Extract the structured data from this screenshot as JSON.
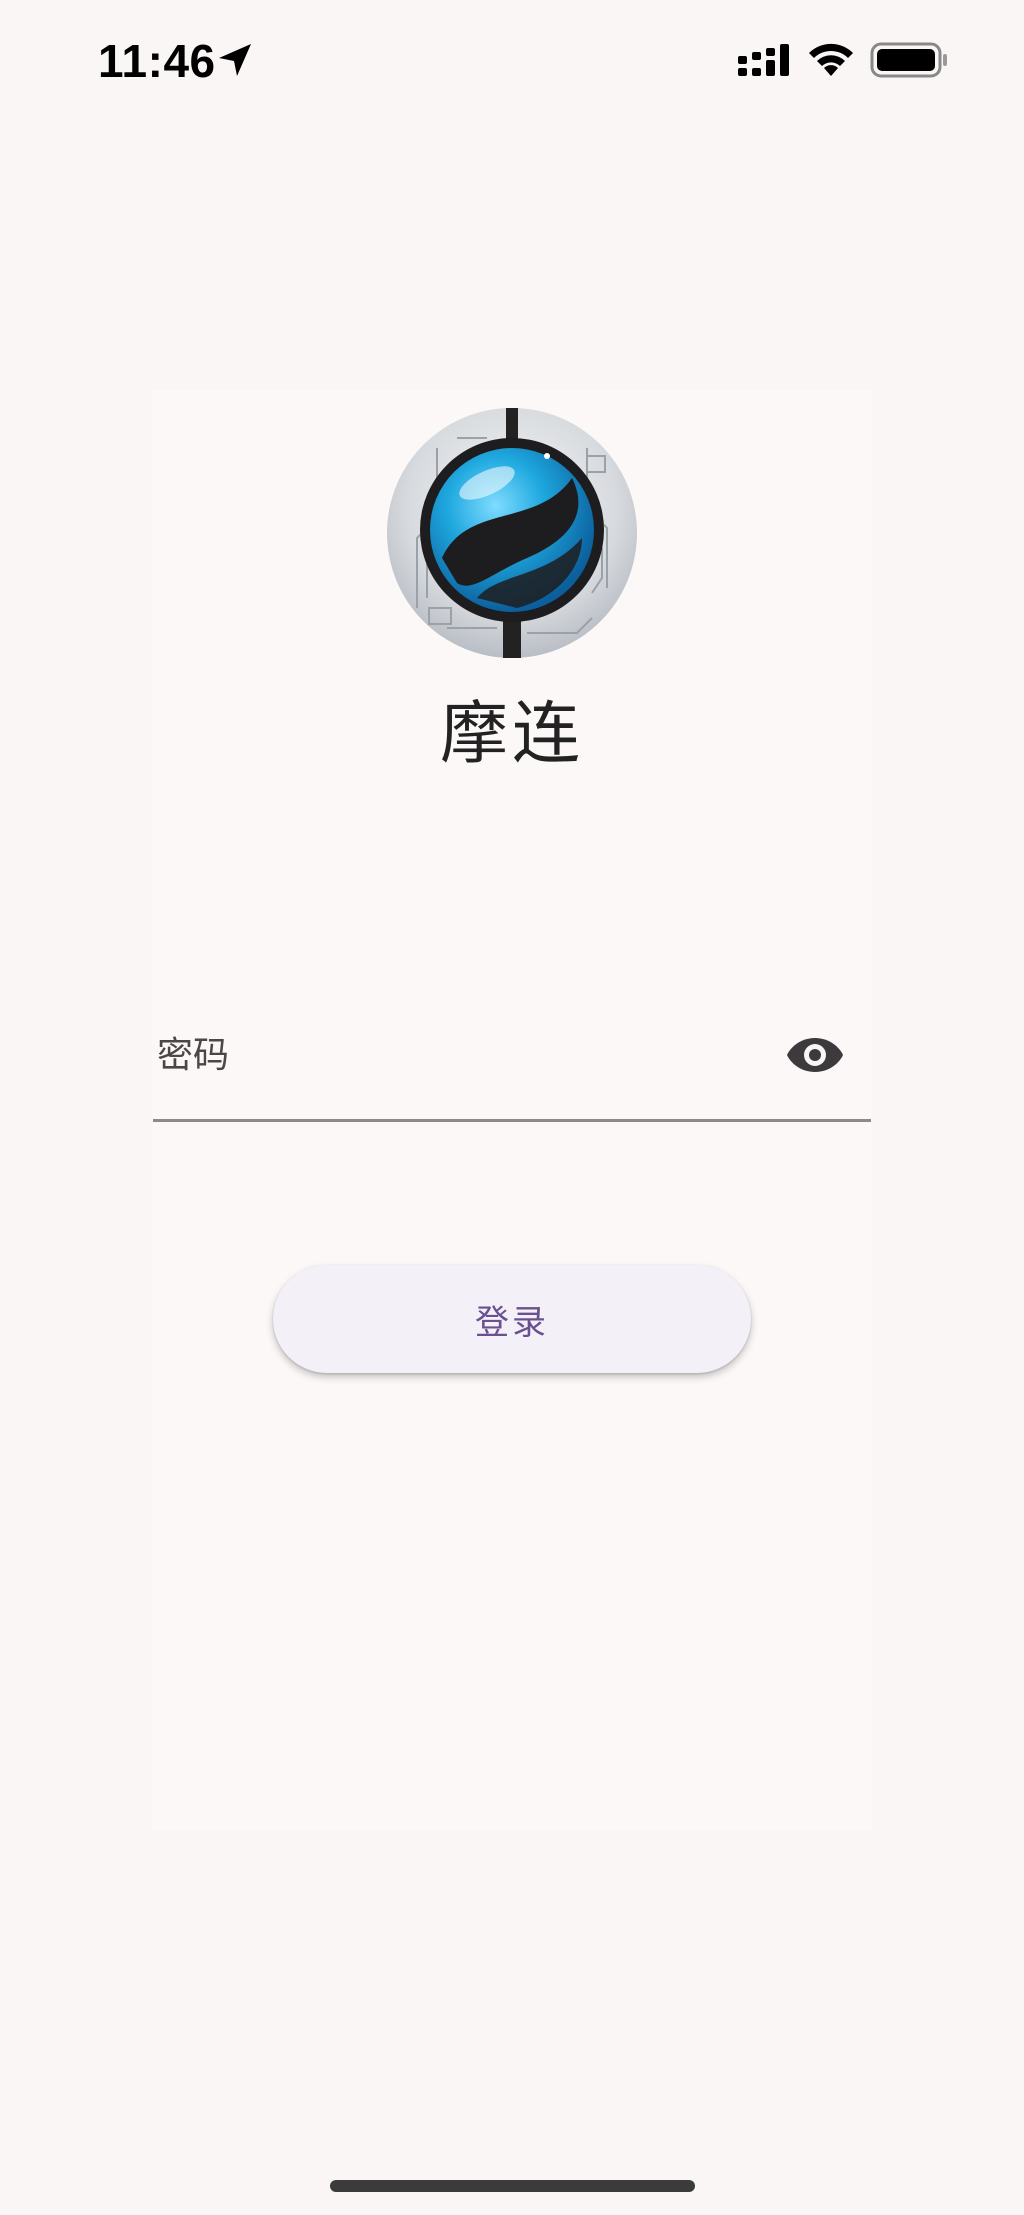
{
  "status_bar": {
    "time": "11:46",
    "location_icon": "location-arrow-icon",
    "signal_icon": "cellular-signal-icon",
    "wifi_icon": "wifi-icon",
    "battery_icon": "battery-icon"
  },
  "app": {
    "logo_icon": "app-logo-globe-icon",
    "name": "摩连"
  },
  "login_form": {
    "password_placeholder": "密码",
    "password_value": "",
    "visibility_icon": "eye-icon",
    "login_label": "登录"
  },
  "colors": {
    "background": "#f9f6f5",
    "button_background": "#f4f0f8",
    "button_text": "#6a5090",
    "logo_blue": "#1fa8df"
  }
}
